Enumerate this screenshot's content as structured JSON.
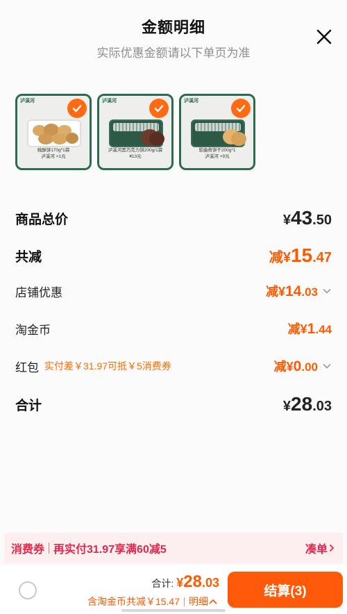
{
  "header": {
    "title": "金额明细",
    "subtitle": "实际优惠金额请以下单页为准"
  },
  "products": [
    {
      "brand": "泸溪河",
      "caption_line1": "桃酥饼170g*1袋",
      "caption_line2": "泸溪河 ×1元"
    },
    {
      "brand": "泸溪河",
      "caption_line1": "泸溪河黑巧克力饼200g/1袋",
      "caption_line2": "¥13元"
    },
    {
      "brand": "泸溪河",
      "caption_line1": "软曲奇饼干200g*1",
      "caption_line2": "泸溪河 ×9元"
    }
  ],
  "rows": {
    "goods_total": {
      "label": "商品总价",
      "yen": "¥",
      "int": "43",
      "dec": ".50"
    },
    "total_reduce": {
      "label": "共减",
      "pre": "减",
      "yen": "¥",
      "int": "15",
      "dec": ".47"
    },
    "shop_discount": {
      "label": "店铺优惠",
      "pre": "减",
      "yen": "¥",
      "int": "14",
      "dec": ".03"
    },
    "taojinbi": {
      "label": "淘金币",
      "pre": "减",
      "yen": "¥",
      "int": "1",
      "dec": ".44"
    },
    "hongbao": {
      "label": "红包",
      "note": "实付差￥31.97可抵￥5消费券",
      "pre": "减",
      "yen": "¥",
      "int": "0",
      "dec": ".00"
    },
    "sum": {
      "label": "合计",
      "yen": "¥",
      "int": "28",
      "dec": ".03"
    }
  },
  "coupon_bar": {
    "tag": "消费券",
    "text": "再实付31.97享满60减5",
    "link": "凑单"
  },
  "bottom_bar": {
    "total_label": "合计:",
    "total_yen": "¥",
    "total_int": "28",
    "total_dec": ".03",
    "sub_text": "含淘金币共减￥15.47",
    "detail_label": "明细",
    "checkout_label": "结算(3)"
  },
  "colors": {
    "accent": "#ff5a00",
    "coupon": "#e0284d",
    "product_border": "#2b6b50"
  },
  "icons": [
    "close-icon",
    "check-icon",
    "chevron-down-icon",
    "chevron-right-icon",
    "chevron-up-icon",
    "radio-icon"
  ]
}
